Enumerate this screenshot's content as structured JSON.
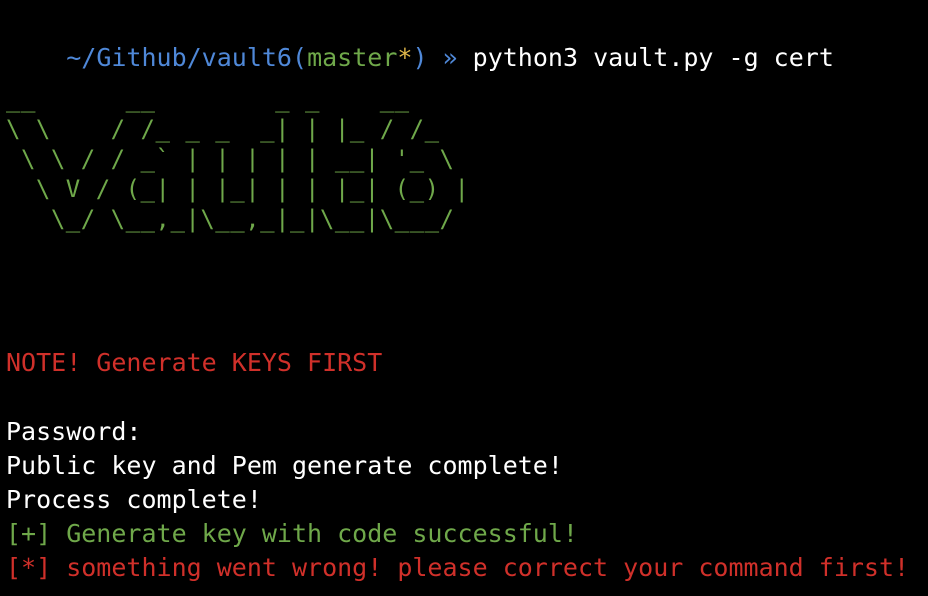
{
  "prompt": {
    "path": "~/Github/vault6",
    "paren_open": "(",
    "branch": "master",
    "dirty_marker": "*",
    "paren_close": ")",
    "separator": " » ",
    "command": "python3 vault.py -g cert"
  },
  "banner": {
    "lines": [
      "__      __        _ _    __ ",
      "\\ \\    / /_ _ _  _| | |_ / /_",
      " \\ \\ / / _` | | | | | __| '_ \\",
      "  \\ V / (_| | |_| | | |_| (_) |",
      "   \\_/ \\__,_|\\__,_|_|\\__|\\___/"
    ]
  },
  "output": {
    "note": "NOTE! Generate KEYS FIRST",
    "password": "Password:",
    "public_key": "Public key and Pem generate complete!",
    "process": "Process complete!",
    "success": "[+] Generate key with code successful!",
    "error": "[*] something went wrong! please correct your command first!"
  },
  "colors": {
    "background": "#000000",
    "path": "#4f88d8",
    "branch": "#6fa84a",
    "dirty": "#e1b84a",
    "text": "#ffffff",
    "banner": "#6fa84a",
    "note": "#d0302a",
    "success": "#6fa84a",
    "error": "#d0302a"
  }
}
